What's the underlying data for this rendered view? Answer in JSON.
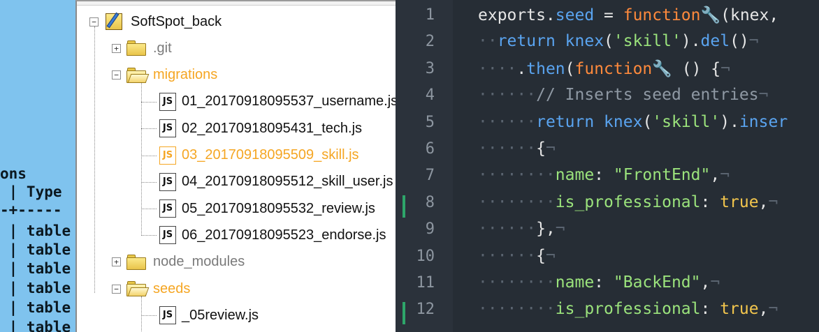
{
  "terminal": {
    "lines": [
      "ons",
      " | Type",
      "-+-----",
      " | table",
      " | table",
      " | table",
      " | table",
      " | table",
      " | table"
    ]
  },
  "tree": {
    "root": {
      "label": "SoftSpot_back",
      "toggle": "−"
    },
    "items": [
      {
        "label": ".git",
        "kind": "folder",
        "toggle": "+",
        "style": "gray"
      },
      {
        "label": "migrations",
        "kind": "folder-open",
        "toggle": "−",
        "style": "orange"
      },
      {
        "label": "01_20170918095537_username.js",
        "kind": "js",
        "style": "normal"
      },
      {
        "label": "02_20170918095431_tech.js",
        "kind": "js",
        "style": "normal"
      },
      {
        "label": "03_20170918095509_skill.js",
        "kind": "js",
        "style": "orange"
      },
      {
        "label": "04_20170918095512_skill_user.js",
        "kind": "js",
        "style": "normal"
      },
      {
        "label": "05_20170918095532_review.js",
        "kind": "js",
        "style": "normal"
      },
      {
        "label": "06_20170918095523_endorse.js",
        "kind": "js",
        "style": "normal"
      },
      {
        "label": "node_modules",
        "kind": "folder",
        "toggle": "+",
        "style": "gray"
      },
      {
        "label": "seeds",
        "kind": "folder-open",
        "toggle": "−",
        "style": "orange"
      },
      {
        "label": "_05review.js",
        "kind": "js",
        "style": "normal"
      }
    ],
    "js_icon_text": "JS"
  },
  "editor": {
    "line_numbers": [
      "1",
      "2",
      "3",
      "4",
      "5",
      "6",
      "7",
      "8",
      "9",
      "10",
      "11",
      "12"
    ],
    "modified_lines": [
      "8",
      "12"
    ],
    "lines": [
      [
        [
          "plain",
          "exports."
        ],
        [
          "kw",
          "seed"
        ],
        [
          "plain",
          " = "
        ],
        [
          "fn",
          "function"
        ],
        [
          "ws",
          "🔧"
        ],
        [
          "plain",
          "(knex,"
        ]
      ],
      [
        [
          "ws",
          "··"
        ],
        [
          "kw",
          "return"
        ],
        [
          "plain",
          " "
        ],
        [
          "kw",
          "knex"
        ],
        [
          "plain",
          "("
        ],
        [
          "str",
          "'skill'"
        ],
        [
          "plain",
          ")."
        ],
        [
          "kw",
          "del"
        ],
        [
          "plain",
          "()"
        ],
        [
          "ws",
          "¬"
        ]
      ],
      [
        [
          "ws",
          "····"
        ],
        [
          "plain",
          "."
        ],
        [
          "kw",
          "then"
        ],
        [
          "plain",
          "("
        ],
        [
          "fn",
          "function"
        ],
        [
          "ws",
          "🔧"
        ],
        [
          "plain",
          " () {"
        ],
        [
          "ws",
          "¬"
        ]
      ],
      [
        [
          "ws",
          "······"
        ],
        [
          "cmt",
          "// Inserts seed entries"
        ],
        [
          "ws",
          "¬"
        ]
      ],
      [
        [
          "ws",
          "······"
        ],
        [
          "kw",
          "return"
        ],
        [
          "plain",
          " "
        ],
        [
          "kw",
          "knex"
        ],
        [
          "plain",
          "("
        ],
        [
          "str",
          "'skill'"
        ],
        [
          "plain",
          ")."
        ],
        [
          "kw",
          "inser"
        ]
      ],
      [
        [
          "ws",
          "······"
        ],
        [
          "plain",
          "{"
        ],
        [
          "ws",
          "¬"
        ]
      ],
      [
        [
          "ws",
          "········"
        ],
        [
          "prop",
          "name"
        ],
        [
          "plain",
          ": "
        ],
        [
          "str",
          "\"FrontEnd\""
        ],
        [
          "plain",
          ","
        ],
        [
          "ws",
          "¬"
        ]
      ],
      [
        [
          "ws",
          "········"
        ],
        [
          "prop",
          "is_professional"
        ],
        [
          "plain",
          ": "
        ],
        [
          "num",
          "true"
        ],
        [
          "plain",
          ","
        ],
        [
          "ws",
          "¬"
        ]
      ],
      [
        [
          "ws",
          "······"
        ],
        [
          "plain",
          "},"
        ],
        [
          "ws",
          "¬"
        ]
      ],
      [
        [
          "ws",
          "······"
        ],
        [
          "plain",
          "{"
        ],
        [
          "ws",
          "¬"
        ]
      ],
      [
        [
          "ws",
          "········"
        ],
        [
          "prop",
          "name"
        ],
        [
          "plain",
          ": "
        ],
        [
          "str",
          "\"BackEnd\""
        ],
        [
          "plain",
          ","
        ],
        [
          "ws",
          "¬"
        ]
      ],
      [
        [
          "ws",
          "········"
        ],
        [
          "prop",
          "is_professional"
        ],
        [
          "plain",
          ": "
        ],
        [
          "num",
          "true"
        ],
        [
          "plain",
          ","
        ],
        [
          "ws",
          "¬"
        ]
      ]
    ]
  }
}
